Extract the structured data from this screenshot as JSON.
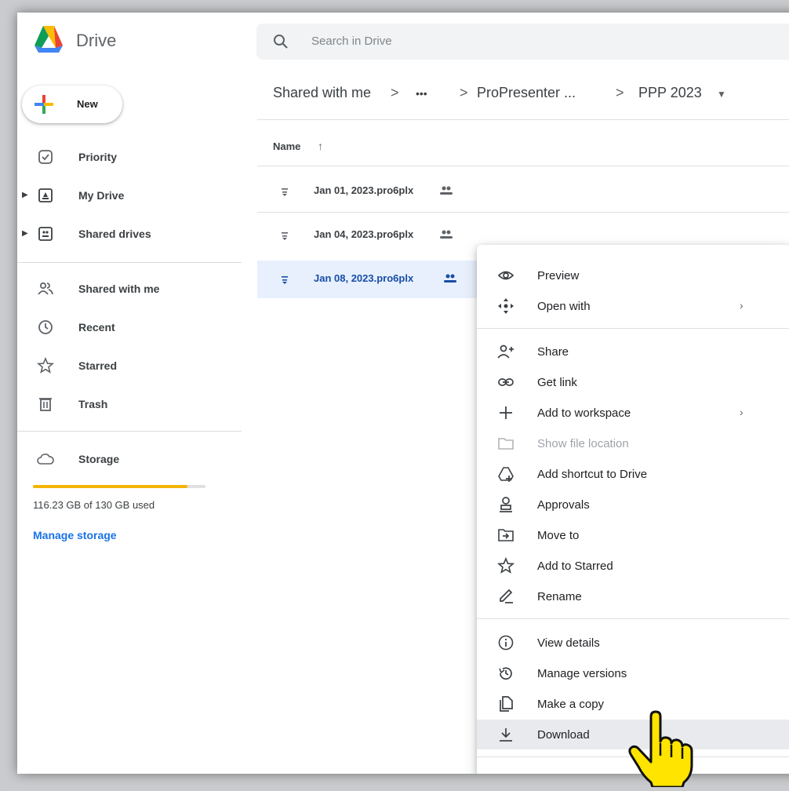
{
  "app": {
    "title": "Drive"
  },
  "search": {
    "placeholder": "Search in Drive"
  },
  "new_button": {
    "label": "New"
  },
  "sidebar": {
    "items": [
      {
        "label": "Priority",
        "icon": "priority-icon"
      },
      {
        "label": "My Drive",
        "icon": "my-drive-icon"
      },
      {
        "label": "Shared drives",
        "icon": "shared-drives-icon"
      },
      {
        "label": "Shared with me",
        "icon": "shared-with-me-icon"
      },
      {
        "label": "Recent",
        "icon": "recent-icon"
      },
      {
        "label": "Starred",
        "icon": "star-icon"
      },
      {
        "label": "Trash",
        "icon": "trash-icon"
      },
      {
        "label": "Storage",
        "icon": "cloud-icon"
      }
    ]
  },
  "storage": {
    "used_text": "116.23 GB of 130 GB used",
    "used_fraction": 0.894,
    "manage_label": "Manage storage"
  },
  "breadcrumb": {
    "items": [
      "Shared with me",
      "•••",
      "ProPresenter ...",
      "PPP 2023"
    ],
    "separator": ">"
  },
  "file_list": {
    "name_header": "Name",
    "files": [
      {
        "name": "Jan 01, 2023.pro6plx",
        "selected": false
      },
      {
        "name": "Jan 04, 2023.pro6plx",
        "selected": false
      },
      {
        "name": "Jan 08, 2023.pro6plx",
        "selected": true
      }
    ]
  },
  "context_menu": {
    "items": [
      {
        "label": "Preview",
        "icon": "eye-icon"
      },
      {
        "label": "Open with",
        "icon": "open-with-icon",
        "submenu": true
      },
      {
        "label": "Share",
        "icon": "add-person-icon"
      },
      {
        "label": "Get link",
        "icon": "link-icon"
      },
      {
        "label": "Add to workspace",
        "icon": "plus-icon",
        "submenu": true
      },
      {
        "label": "Show file location",
        "icon": "folder-icon",
        "disabled": true
      },
      {
        "label": "Add shortcut to Drive",
        "icon": "add-shortcut-icon"
      },
      {
        "label": "Approvals",
        "icon": "approvals-icon"
      },
      {
        "label": "Move to",
        "icon": "move-to-icon"
      },
      {
        "label": "Add to Starred",
        "icon": "star-icon"
      },
      {
        "label": "Rename",
        "icon": "pencil-icon"
      },
      {
        "label": "View details",
        "icon": "info-icon"
      },
      {
        "label": "Manage versions",
        "icon": "history-icon"
      },
      {
        "label": "Make a copy",
        "icon": "copy-icon"
      },
      {
        "label": "Download",
        "icon": "download-icon",
        "highlighted": true
      }
    ]
  },
  "colors": {
    "accent_blue": "#1a73e8",
    "selected_row_bg": "#e8f0fe",
    "storage_fill": "#f4b400",
    "menu_highlight": "#e8eaed"
  }
}
